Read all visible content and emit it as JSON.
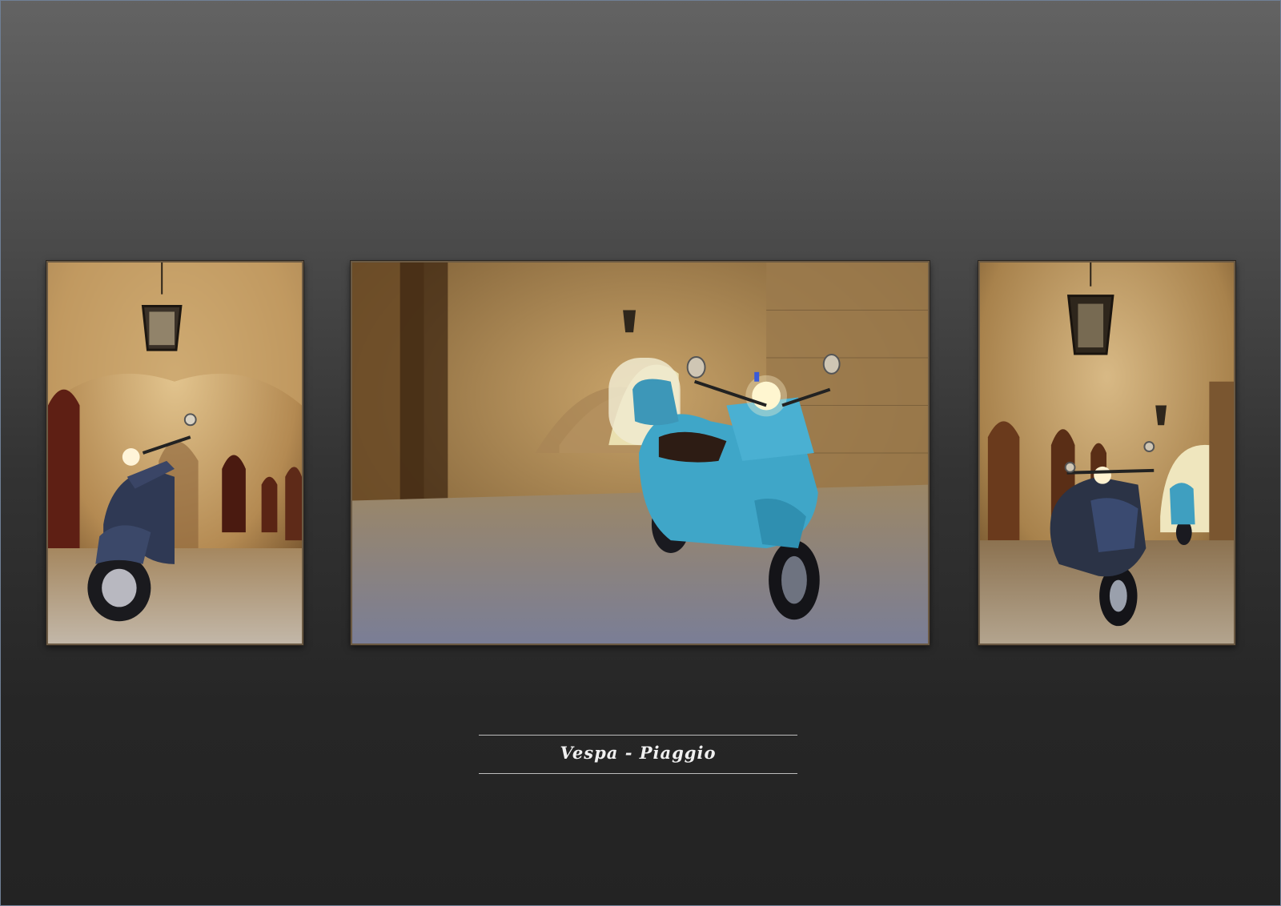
{
  "gallery": {
    "photos": [
      {
        "subject": "dark-blue-scooter-under-arcade-with-lantern"
      },
      {
        "subject": "light-blue-scooter-in-stone-arched-passage"
      },
      {
        "subject": "dark-scooter-in-arcade-with-second-scooter-behind"
      }
    ]
  },
  "caption": {
    "text": "Vespa - Piaggio"
  },
  "colors": {
    "background_top": "#636363",
    "background_bottom": "#232323",
    "stone_warm": "#c9a46a",
    "scooter_light_blue": "#3fa6c8",
    "scooter_dark": "#2b3346",
    "caption_text": "#f0f0f0"
  }
}
